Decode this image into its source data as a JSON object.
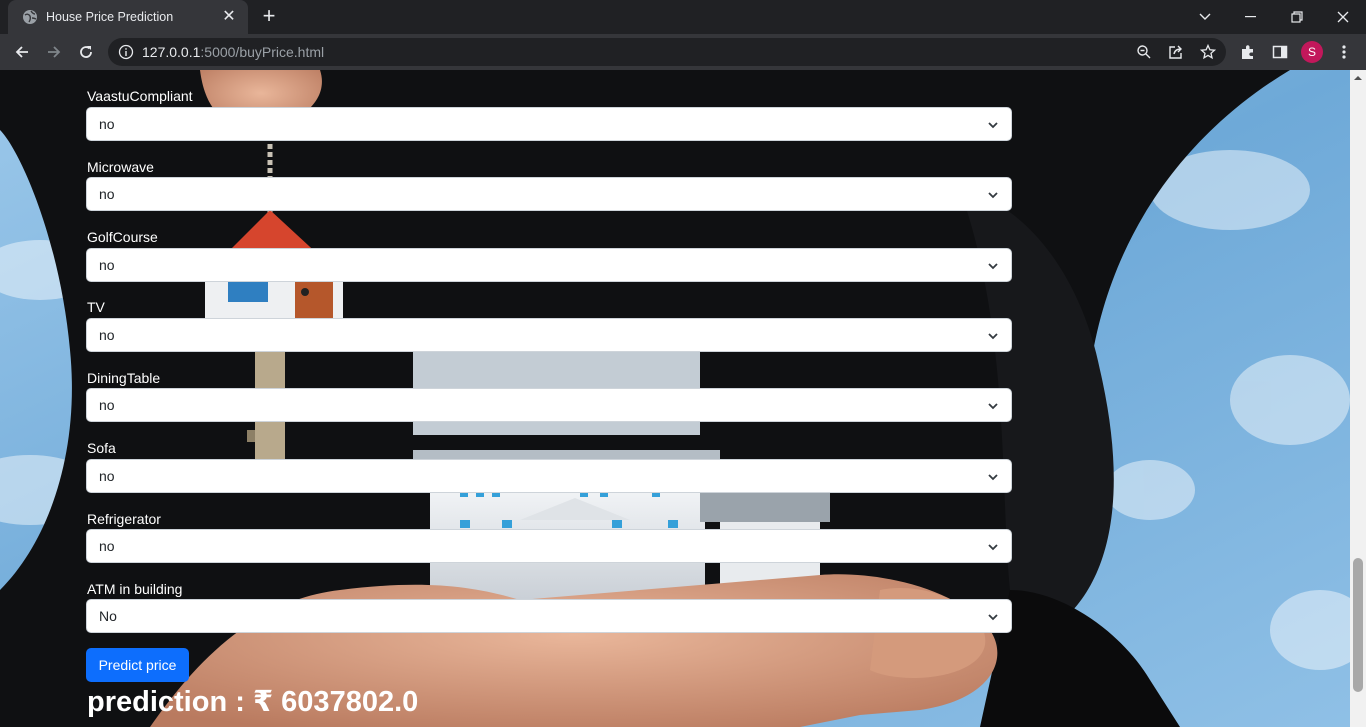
{
  "browser": {
    "tab_title": "House Price Prediction",
    "url_host": "127.0.0.1",
    "url_path": ":5000/buyPrice.html",
    "avatar_letter": "S",
    "icons": {
      "favicon": "globe-icon",
      "tab_close": "close-icon",
      "new_tab": "plus-icon",
      "back": "back-arrow-icon",
      "forward": "forward-arrow-icon",
      "reload": "reload-icon",
      "site_info": "info-icon",
      "zoom": "zoom-out-icon",
      "share": "share-icon",
      "bookmark": "star-icon",
      "extensions": "puzzle-icon",
      "side_panel": "side-panel-icon",
      "menu": "kebab-menu-icon"
    }
  },
  "form": {
    "fields": [
      {
        "label": "VaastuCompliant",
        "value": "no"
      },
      {
        "label": "Microwave",
        "value": "no"
      },
      {
        "label": "GolfCourse",
        "value": "no"
      },
      {
        "label": "TV",
        "value": "no"
      },
      {
        "label": "DiningTable",
        "value": "no"
      },
      {
        "label": "Sofa",
        "value": "no"
      },
      {
        "label": "Refrigerator",
        "value": "no"
      },
      {
        "label": "ATM in building",
        "value": "No"
      }
    ],
    "submit_label": "Predict price",
    "prediction_text": "prediction : ₹ 6037802.0"
  },
  "colors": {
    "primary": "#0d6efd",
    "chrome_dark": "#202124",
    "chrome_toolbar": "#35363a",
    "sky": "#7fb6df"
  }
}
